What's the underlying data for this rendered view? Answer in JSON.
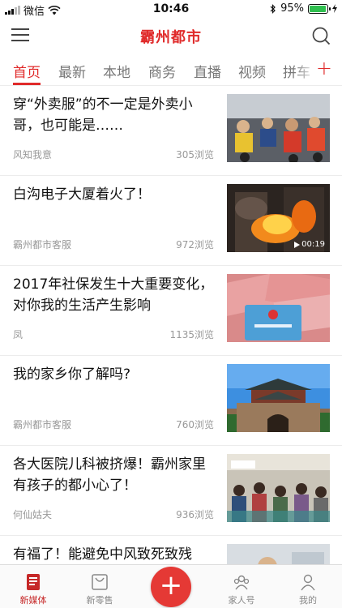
{
  "status_bar": {
    "carrier": "微信",
    "time": "10:46",
    "battery": "95%",
    "battery_level": 0.95
  },
  "header": {
    "title": "霸州都市",
    "menu_icon": "menu-icon",
    "search_icon": "search-icon"
  },
  "tabs": [
    {
      "label": "首页",
      "active": true
    },
    {
      "label": "最新"
    },
    {
      "label": "本地"
    },
    {
      "label": "商务"
    },
    {
      "label": "直播"
    },
    {
      "label": "视频"
    },
    {
      "label": "拼车"
    }
  ],
  "tab_add_icon": "plus-icon",
  "feed": [
    {
      "title": "穿“外卖服”的不一定是外卖小哥，也可能是……",
      "source": "风知我意",
      "views": "305浏览",
      "image": "scooter-riders-photo"
    },
    {
      "title": "白沟电子大厦着火了！",
      "source": "霸州都市客服",
      "views": "972浏览",
      "image": "building-fire-video",
      "duration": "00:19"
    },
    {
      "title": "2017年社保发生十大重要变化，对你我的生活产生影响",
      "source": "凤",
      "views": "1135浏览",
      "image": "social-security-card-photo"
    },
    {
      "title": "我的家乡你了解吗?",
      "source": "霸州都市客服",
      "views": "760浏览",
      "image": "city-gate-photo"
    },
    {
      "title": "各大医院儿科被挤爆！霸州家里有孩子的都小心了！",
      "source": "何仙姑夫",
      "views": "936浏览",
      "image": "hospital-crowd-photo"
    },
    {
      "title": "有福了！能避免中风致死致残",
      "source": "",
      "views": "",
      "image": "doctor-photo"
    }
  ],
  "bottom_nav": [
    {
      "label": "新媒体",
      "icon": "news-icon",
      "active": true
    },
    {
      "label": "新零售",
      "icon": "shopping-bag-icon"
    },
    {
      "label": "",
      "icon": "add-icon"
    },
    {
      "label": "家人号",
      "icon": "family-icon"
    },
    {
      "label": "我的",
      "icon": "profile-icon"
    }
  ],
  "colors": {
    "accent": "#e02a2a",
    "text": "#111111",
    "muted": "#999999"
  }
}
